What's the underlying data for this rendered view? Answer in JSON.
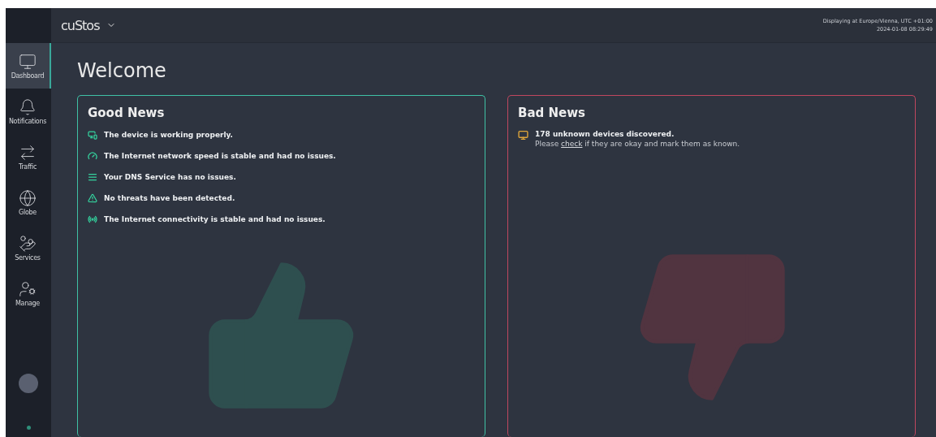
{
  "header": {
    "logo": "cuStos",
    "timezone": "Displaying at Europe/Vienna, UTC +01:00",
    "datetime": "2024-01-08 08:29:49"
  },
  "sidebar": {
    "items": [
      {
        "label": "Dashboard",
        "kind": "dashboard",
        "selected": true
      },
      {
        "label": "Notifications",
        "kind": "bell",
        "selected": false
      },
      {
        "label": "Traffic",
        "kind": "traffic",
        "selected": false
      },
      {
        "label": "Globe",
        "kind": "globe",
        "selected": false
      },
      {
        "label": "Services",
        "kind": "services",
        "selected": false
      },
      {
        "label": "Manage",
        "kind": "manage",
        "selected": false
      }
    ]
  },
  "page": {
    "title": "Welcome"
  },
  "good_news": {
    "title": "Good News",
    "items": [
      {
        "kind": "device",
        "text": "The device is working properly."
      },
      {
        "kind": "speed",
        "text": "The Internet network speed is stable and had no issues."
      },
      {
        "kind": "dns",
        "text": "Your DNS Service has no issues."
      },
      {
        "kind": "threat",
        "text": "No threats have been detected."
      },
      {
        "kind": "connectivity",
        "text": "The Internet connectivity is stable and had no issues."
      }
    ]
  },
  "bad_news": {
    "title": "Bad News",
    "items": [
      {
        "kind": "devices",
        "text": "178 unknown devices discovered.",
        "detail_before": "Please",
        "link": "check",
        "detail_after": "if they are okay and mark them as known."
      }
    ]
  }
}
